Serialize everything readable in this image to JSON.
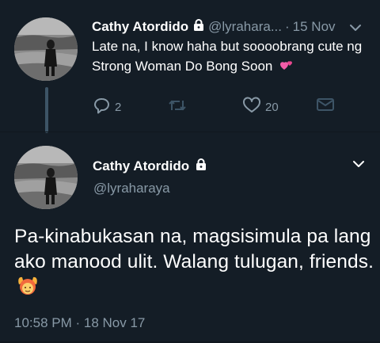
{
  "tweet1": {
    "name": "Cathy Atordido",
    "handle": "@lyrahara...",
    "separator": "·",
    "time": "15 Nov",
    "text": "Late na, I know haha but soooobrang cute ng Strong Woman Do Bong Soon",
    "emoji": "💞",
    "actions": {
      "reply_count": "2",
      "retweet_count": "",
      "like_count": "20"
    }
  },
  "tweet2": {
    "name": "Cathy Atordido",
    "handle": "@lyraharaya",
    "text": "Pa-kinabukasan na, magsisimula pa lang ako manood ulit. Walang tulugan, friends.",
    "emoji": "🙆",
    "timestamp": "10:58 PM · 18 Nov 17"
  },
  "colors": {
    "background": "#141d26",
    "secondary_text": "#8899a6",
    "thread_line": "#3d5466"
  },
  "icons": {
    "lock": "lock-icon",
    "chevron": "chevron-down-icon",
    "reply": "reply-icon",
    "retweet": "retweet-icon",
    "like": "heart-icon",
    "dm": "envelope-icon"
  }
}
